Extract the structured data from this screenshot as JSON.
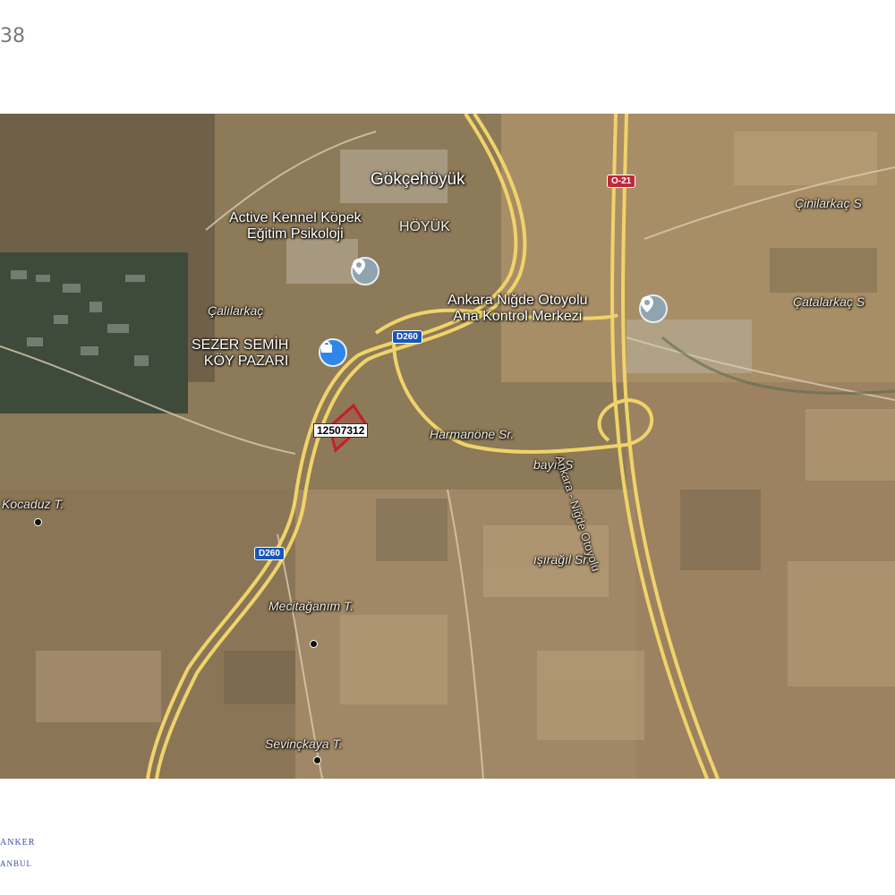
{
  "page_number": "38",
  "footer": {
    "line1": "ANKER",
    "line2": "ANBUL"
  },
  "map": {
    "place_labels": {
      "town": "Gökçehöyük",
      "town_overlay": "HÖYÜK",
      "kennel": "Active Kennel Köpek\nEğitim Psikoloji",
      "control_center": "Ankara Niğde Otoyolu\nAna Kontrol Merkezi",
      "market": "SEZER SEMİH\nKÖY PAZARI",
      "cinilarkac": "Çinilarkaç S",
      "catalarkac": "Çatalarkaç S",
      "calilarkac": "Çalılarkaç",
      "kocaduz": "Kocaduz T.",
      "harmanone": "Harmanöne Sr.",
      "bayir": "bayır S",
      "isiragil": "ışırağıl Sr.",
      "mecitaganim": "Mecitağanım T.",
      "sevinckaya": "Sevinçkaya T.",
      "otoyolu": "Ankara - Niğde Otoyolu"
    },
    "road_shields": {
      "d260_top": "D260",
      "d260_bottom": "D260",
      "o21": "O-21"
    },
    "parcel_label": "12507312",
    "pins": {
      "kennel": "location-pin-grey",
      "control": "location-pin-grey",
      "market": "shopping-bag-pin-blue"
    },
    "colors": {
      "road": "#f0d36a",
      "parcel": "#c21f2a",
      "pin_grey": "#8fa3b0",
      "pin_blue": "#2f86e8"
    }
  }
}
